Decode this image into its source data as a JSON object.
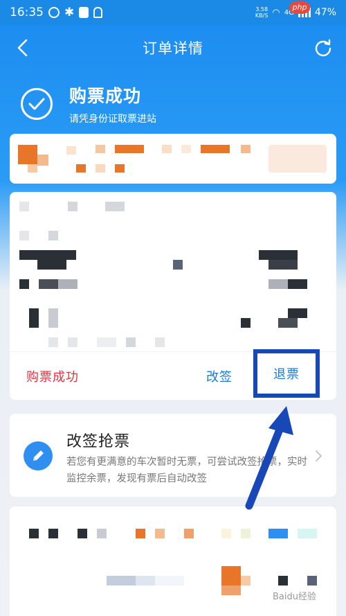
{
  "status_bar": {
    "time": "16:35",
    "network_speed_value": "3.58",
    "network_speed_unit": "KB/S",
    "battery": "47%",
    "signal": "4G",
    "site_logo": "php"
  },
  "nav": {
    "title": "订单详情",
    "back_icon": "chevron-left-icon",
    "refresh_icon": "refresh-icon"
  },
  "success": {
    "title": "购票成功",
    "subtitle": "请凭身份证取票进站"
  },
  "ticket": {
    "status_text": "购票成功",
    "change_label": "改签",
    "refund_label": "退票"
  },
  "grab": {
    "title": "改签抢票",
    "description": "若您有更满意的车次暂时无票，可尝试改签抢票，实时监控余票，发现有票后自动改签"
  },
  "colors": {
    "primary_blue": "#1a8cf0",
    "status_red": "#e5323e",
    "link_blue": "#1879d6",
    "annotation_blue": "#1847b8",
    "orange": "#e8762a"
  },
  "watermark": "Baidu经验"
}
